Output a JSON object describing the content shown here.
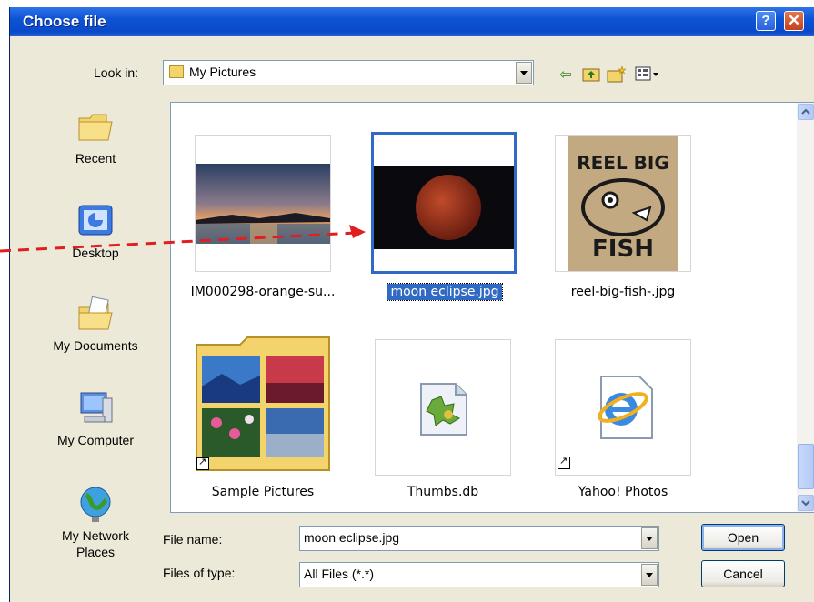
{
  "dialog": {
    "title": "Choose file",
    "help_glyph": "?",
    "close_glyph": "✕"
  },
  "look_in": {
    "label": "Look in:",
    "value": "My Pictures"
  },
  "places": [
    {
      "label": "Recent",
      "icon": "recent-folder-icon"
    },
    {
      "label": "Desktop",
      "icon": "desktop-icon"
    },
    {
      "label": "My Documents",
      "icon": "my-documents-icon"
    },
    {
      "label": "My Computer",
      "icon": "my-computer-icon"
    },
    {
      "label": "My Network Places",
      "icon": "network-places-icon"
    }
  ],
  "files": [
    {
      "name": "IM000298-orange-su...",
      "icon": "sunset-photo-thumbnail",
      "selected": false
    },
    {
      "name": "moon eclipse.jpg",
      "icon": "moon-photo-thumbnail",
      "selected": true
    },
    {
      "name": "reel-big-fish-.jpg",
      "icon": "band-logo-thumbnail",
      "selected": false
    },
    {
      "name": "Sample Pictures",
      "icon": "folder-thumbnail",
      "selected": false
    },
    {
      "name": "Thumbs.db",
      "icon": "db-file-icon",
      "selected": false
    },
    {
      "name": "Yahoo! Photos",
      "icon": "ie-shortcut-icon",
      "selected": false
    }
  ],
  "thumb_text": {
    "fish_top": "REEL BIG",
    "fish_bottom": "FISH"
  },
  "file_name": {
    "label": "File name:",
    "value": "moon eclipse.jpg"
  },
  "file_type": {
    "label": "Files of type:",
    "value": "All Files (*.*)"
  },
  "buttons": {
    "open": "Open",
    "cancel": "Cancel"
  },
  "colors": {
    "title_bar": "#0A49C9",
    "selection": "#316AC5",
    "annotation_arrow": "#E02020"
  }
}
